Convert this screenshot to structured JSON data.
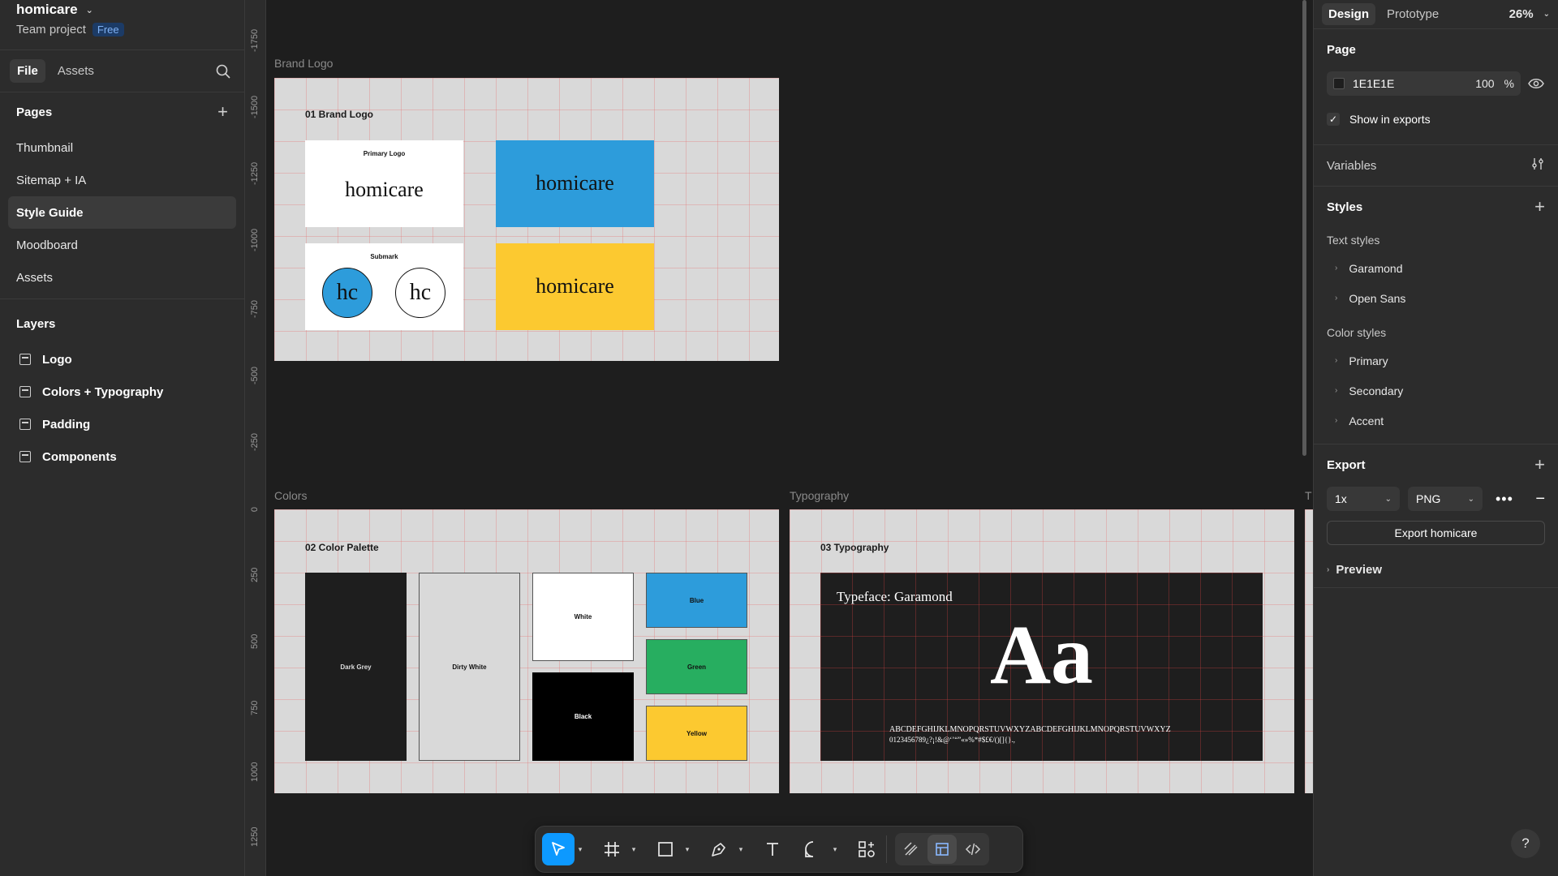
{
  "project": {
    "name": "homicare",
    "subtitle": "Team project",
    "plan_badge": "Free"
  },
  "left_tabs": {
    "file": "File",
    "assets": "Assets"
  },
  "pages": {
    "title": "Pages",
    "items": [
      "Thumbnail",
      "Sitemap + IA",
      "Style Guide",
      "Moodboard",
      "Assets"
    ],
    "active": "Style Guide"
  },
  "layers": {
    "title": "Layers",
    "items": [
      "Logo",
      "Colors + Typography",
      "Padding",
      "Components"
    ]
  },
  "ruler_ticks": [
    "-1750",
    "-1500",
    "-1250",
    "-1000",
    "-750",
    "-500",
    "-250",
    "0",
    "250",
    "500",
    "750",
    "1000",
    "1250"
  ],
  "canvas": {
    "brand_logo": {
      "label": "Brand Logo",
      "title": "01 Brand Logo",
      "primary_caption": "Primary Logo",
      "logo_text": "homicare",
      "submark_caption": "Submark",
      "submark_text": "hc"
    },
    "colors": {
      "label": "Colors",
      "title": "02 Color Palette",
      "swatches": [
        {
          "name": "Dark Grey",
          "color": "#1e1e1e"
        },
        {
          "name": "Dirty White",
          "color": "#d9d9d9"
        },
        {
          "name": "White",
          "color": "#ffffff"
        },
        {
          "name": "Black",
          "color": "#000000"
        },
        {
          "name": "Blue",
          "color": "#2d9cdb"
        },
        {
          "name": "Green",
          "color": "#27ae60"
        },
        {
          "name": "Yellow",
          "color": "#fcc930"
        }
      ]
    },
    "typography": {
      "label": "Typography",
      "title": "03 Typography",
      "typeface": "Typeface: Garamond",
      "sample": "Aa",
      "glyphs_line1": "ABCDEFGHIJKLMNOPQRSTUVWXYZABCDEFGHIJKLMNOPQRSTUVWXYZ",
      "glyphs_line2": "0123456789¿?¡!&@‘’“”«»%*#$£€/()[]{}.,"
    }
  },
  "toolbar": {
    "tools": [
      "move-tool",
      "frame-tool",
      "shape-tool",
      "pen-tool",
      "text-tool",
      "comment-tool",
      "actions-tool"
    ],
    "modes": [
      "draw-mode",
      "design-mode",
      "dev-mode"
    ]
  },
  "right": {
    "tabs": {
      "design": "Design",
      "prototype": "Prototype"
    },
    "zoom": "26%",
    "page": {
      "title": "Page",
      "fill_hex": "1E1E1E",
      "opacity": "100",
      "unit": "%",
      "show_exports": "Show in exports"
    },
    "variables": "Variables",
    "styles": {
      "title": "Styles",
      "text_head": "Text styles",
      "text_items": [
        "Garamond",
        "Open Sans"
      ],
      "color_head": "Color styles",
      "color_items": [
        "Primary",
        "Secondary",
        "Accent"
      ]
    },
    "export": {
      "title": "Export",
      "scale": "1x",
      "format": "PNG",
      "button": "Export homicare",
      "preview": "Preview"
    }
  },
  "colors": {
    "accent": "#0d99ff",
    "panel": "#2c2c2c",
    "canvas": "#1e1e1e"
  }
}
